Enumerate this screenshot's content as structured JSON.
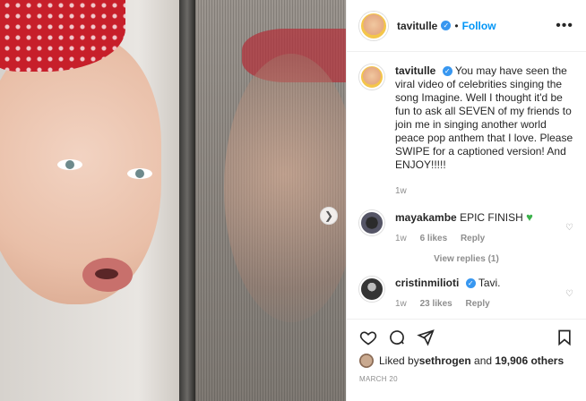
{
  "post": {
    "username": "tavitulle",
    "follow_label": "Follow",
    "dot_sep": "•",
    "caption": "You may have seen the viral video of celebrities singing the song Imagine. Well I thought it'd be fun to ask all SEVEN of my friends to join me in singing another world peace pop anthem that I love. Please SWIPE for a captioned version! And ENJOY!!!!!",
    "caption_age": "1w"
  },
  "comments": [
    {
      "username": "mayakambe",
      "text": "EPIC FINISH",
      "emoji": "green-heart",
      "age": "1w",
      "likes": "6 likes",
      "reply": "Reply"
    },
    {
      "username": "cristinmilioti",
      "text": "Tavi.",
      "age": "1w",
      "likes": "23 likes",
      "reply": "Reply"
    }
  ],
  "view_replies": "View replies (1)",
  "liked_by": {
    "prefix": "Liked by ",
    "user": "sethrogen",
    "middle": " and ",
    "others": "19,906 others"
  },
  "date": "MARCH 20",
  "icons": [
    "heart-icon",
    "comment-icon",
    "share-icon",
    "bookmark-icon",
    "more-options-icon",
    "next-arrow-icon",
    "verified-icon"
  ]
}
